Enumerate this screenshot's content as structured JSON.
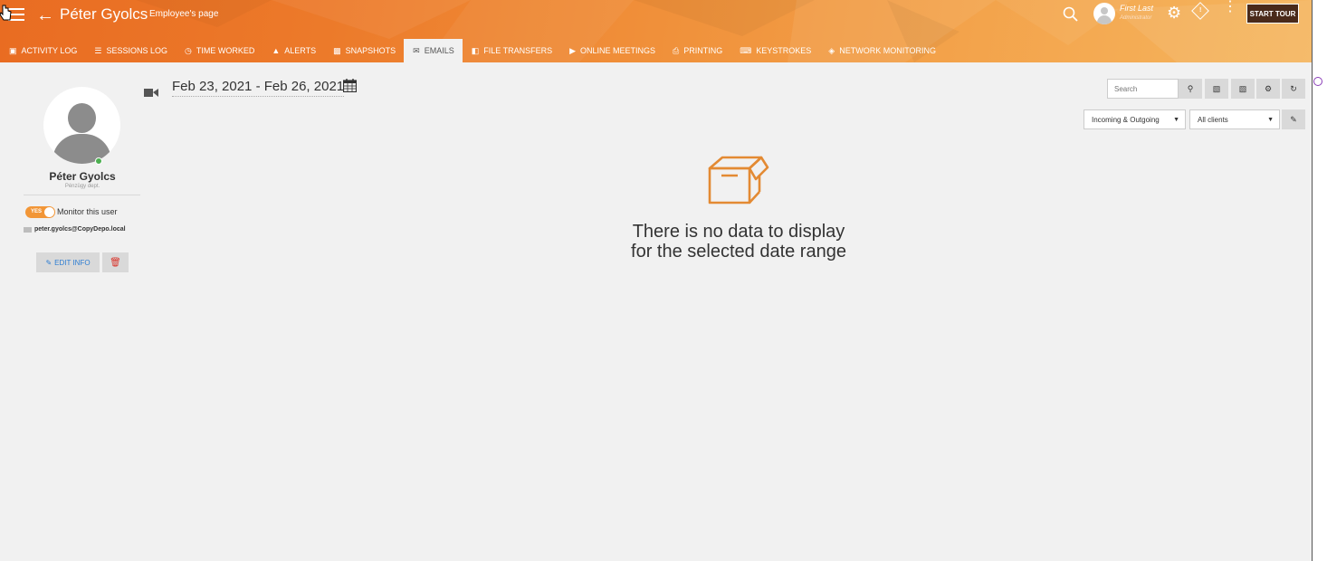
{
  "header": {
    "employee_name": "Péter Gyolcs",
    "page_subtitle": "Employee's page",
    "account_name": "First Last",
    "account_role": "Administrator",
    "start_tour_label": "START TOUR",
    "accent_color": "#ee8430"
  },
  "tabs": [
    {
      "label": "ACTIVITY LOG",
      "icon": "monitor-icon"
    },
    {
      "label": "SESSIONS LOG",
      "icon": "list-icon"
    },
    {
      "label": "TIME WORKED",
      "icon": "clock-icon"
    },
    {
      "label": "ALERTS",
      "icon": "bell-icon"
    },
    {
      "label": "SNAPSHOTS",
      "icon": "image-icon"
    },
    {
      "label": "EMAILS",
      "icon": "envelope-icon",
      "active": true
    },
    {
      "label": "FILE TRANSFERS",
      "icon": "file-icon"
    },
    {
      "label": "ONLINE MEETINGS",
      "icon": "video-icon"
    },
    {
      "label": "PRINTING",
      "icon": "printer-icon"
    },
    {
      "label": "KEYSTROKES",
      "icon": "keyboard-icon"
    },
    {
      "label": "NETWORK MONITORING",
      "icon": "wifi-icon"
    }
  ],
  "profile": {
    "name": "Péter Gyolcs",
    "department": "Pénzügy dept.",
    "toggle_label": "YES",
    "monitor_label": "Monitor this user",
    "email": "peter.gyolcs@CopyDepo.local",
    "edit_label": "EDIT INFO",
    "status": "online"
  },
  "toolbar": {
    "date_range": "Feb 23, 2021 - Feb 26, 2021",
    "search_placeholder": "Search",
    "direction_filter": "Incoming & Outgoing",
    "client_filter": "All clients"
  },
  "empty_state": {
    "message": "There is no data to display for the selected date range"
  }
}
